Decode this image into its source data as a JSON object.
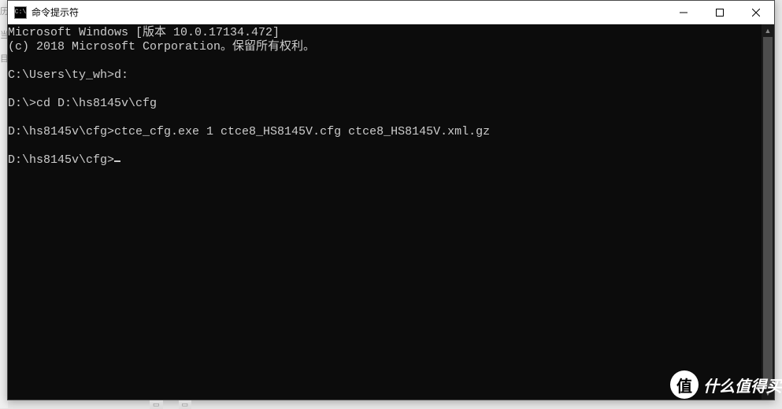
{
  "window": {
    "title": "命令提示符",
    "icon_label": "C:\\"
  },
  "terminal": {
    "lines": [
      "Microsoft Windows [版本 10.0.17134.472]",
      "(c) 2018 Microsoft Corporation。保留所有权利。",
      "",
      "C:\\Users\\ty_wh>d:",
      "",
      "D:\\>cd D:\\hs8145v\\cfg",
      "",
      "D:\\hs8145v\\cfg>ctce_cfg.exe 1 ctce8_HS8145V.cfg ctce8_HS8145V.xml.gz",
      "",
      "D:\\hs8145v\\cfg>"
    ],
    "show_cursor": true
  },
  "watermark": {
    "badge": "值",
    "text": "什么值得买"
  },
  "bg_hints": [
    "历",
    "当",
    "目"
  ]
}
